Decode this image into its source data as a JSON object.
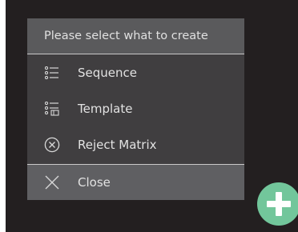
{
  "menu": {
    "header": "Please select what to create",
    "items": [
      {
        "label": "Sequence",
        "icon": "list-icon"
      },
      {
        "label": "Template",
        "icon": "template-list-icon"
      },
      {
        "label": "Reject Matrix",
        "icon": "circle-x-icon"
      }
    ],
    "close_label": "Close",
    "close_icon": "close-icon"
  },
  "fab": {
    "icon": "plus-icon",
    "color": "#72c69b"
  },
  "colors": {
    "background": "#231f20",
    "menu": "#403e40",
    "header": "#5a5a5c",
    "close_row": "#5f5f62",
    "text": "#e2e2e2"
  }
}
